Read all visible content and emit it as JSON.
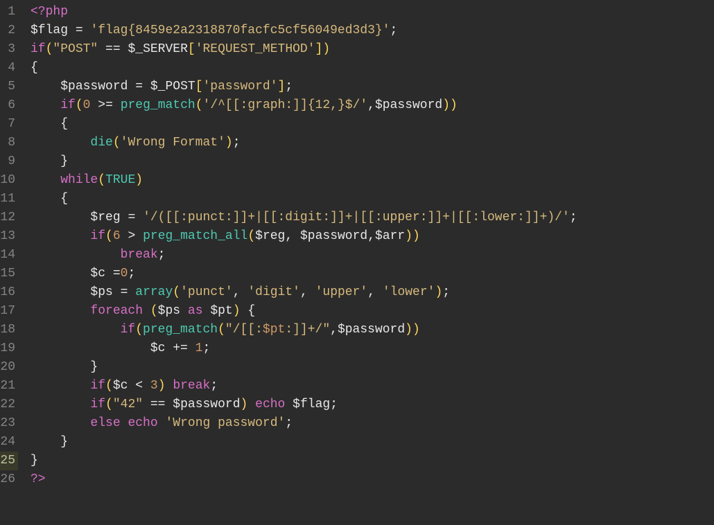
{
  "lineCount": 26,
  "currentLine": 25,
  "lines": [
    [
      {
        "t": "<?php",
        "c": "tk-tag"
      }
    ],
    [
      {
        "t": "$flag",
        "c": "tk-var"
      },
      {
        "t": " ",
        "c": "tk-default"
      },
      {
        "t": "=",
        "c": "tk-op"
      },
      {
        "t": " ",
        "c": "tk-default"
      },
      {
        "t": "'flag{8459e2a2318870facfc5cf56049ed3d3}'",
        "c": "tk-string"
      },
      {
        "t": ";",
        "c": "tk-punct"
      }
    ],
    [
      {
        "t": "if",
        "c": "tk-keyword"
      },
      {
        "t": "(",
        "c": "tk-paren"
      },
      {
        "t": "\"POST\"",
        "c": "tk-string"
      },
      {
        "t": " ",
        "c": "tk-default"
      },
      {
        "t": "==",
        "c": "tk-op"
      },
      {
        "t": " ",
        "c": "tk-default"
      },
      {
        "t": "$_SERVER",
        "c": "tk-var"
      },
      {
        "t": "[",
        "c": "tk-paren"
      },
      {
        "t": "'REQUEST_METHOD'",
        "c": "tk-string"
      },
      {
        "t": "]",
        "c": "tk-paren"
      },
      {
        "t": ")",
        "c": "tk-paren"
      }
    ],
    [
      {
        "t": "{",
        "c": "tk-punct"
      }
    ],
    [
      {
        "t": "    ",
        "c": "tk-default"
      },
      {
        "t": "$password",
        "c": "tk-var"
      },
      {
        "t": " ",
        "c": "tk-default"
      },
      {
        "t": "=",
        "c": "tk-op"
      },
      {
        "t": " ",
        "c": "tk-default"
      },
      {
        "t": "$_POST",
        "c": "tk-var"
      },
      {
        "t": "[",
        "c": "tk-paren"
      },
      {
        "t": "'password'",
        "c": "tk-string"
      },
      {
        "t": "]",
        "c": "tk-paren"
      },
      {
        "t": ";",
        "c": "tk-punct"
      }
    ],
    [
      {
        "t": "    ",
        "c": "tk-default"
      },
      {
        "t": "if",
        "c": "tk-keyword"
      },
      {
        "t": "(",
        "c": "tk-paren"
      },
      {
        "t": "0",
        "c": "tk-number"
      },
      {
        "t": " ",
        "c": "tk-default"
      },
      {
        "t": ">=",
        "c": "tk-op"
      },
      {
        "t": " ",
        "c": "tk-default"
      },
      {
        "t": "preg_match",
        "c": "tk-func"
      },
      {
        "t": "(",
        "c": "tk-paren"
      },
      {
        "t": "'/^[[:graph:]]{12,}$/'",
        "c": "tk-string"
      },
      {
        "t": ",",
        "c": "tk-punct"
      },
      {
        "t": "$password",
        "c": "tk-var"
      },
      {
        "t": ")",
        "c": "tk-paren"
      },
      {
        "t": ")",
        "c": "tk-paren"
      }
    ],
    [
      {
        "t": "    ",
        "c": "tk-default"
      },
      {
        "t": "{",
        "c": "tk-punct"
      }
    ],
    [
      {
        "t": "        ",
        "c": "tk-default"
      },
      {
        "t": "die",
        "c": "tk-func"
      },
      {
        "t": "(",
        "c": "tk-paren"
      },
      {
        "t": "'Wrong Format'",
        "c": "tk-string"
      },
      {
        "t": ")",
        "c": "tk-paren"
      },
      {
        "t": ";",
        "c": "tk-punct"
      }
    ],
    [
      {
        "t": "    ",
        "c": "tk-default"
      },
      {
        "t": "}",
        "c": "tk-punct"
      }
    ],
    [
      {
        "t": "    ",
        "c": "tk-default"
      },
      {
        "t": "while",
        "c": "tk-keyword"
      },
      {
        "t": "(",
        "c": "tk-paren"
      },
      {
        "t": "TRUE",
        "c": "tk-const"
      },
      {
        "t": ")",
        "c": "tk-paren"
      }
    ],
    [
      {
        "t": "    ",
        "c": "tk-default"
      },
      {
        "t": "{",
        "c": "tk-punct"
      }
    ],
    [
      {
        "t": "        ",
        "c": "tk-default"
      },
      {
        "t": "$reg",
        "c": "tk-var"
      },
      {
        "t": " ",
        "c": "tk-default"
      },
      {
        "t": "=",
        "c": "tk-op"
      },
      {
        "t": " ",
        "c": "tk-default"
      },
      {
        "t": "'/([[:punct:]]+|[[:digit:]]+|[[:upper:]]+|[[:lower:]]+)/'",
        "c": "tk-string"
      },
      {
        "t": ";",
        "c": "tk-punct"
      }
    ],
    [
      {
        "t": "        ",
        "c": "tk-default"
      },
      {
        "t": "if",
        "c": "tk-keyword"
      },
      {
        "t": "(",
        "c": "tk-paren"
      },
      {
        "t": "6",
        "c": "tk-number"
      },
      {
        "t": " ",
        "c": "tk-default"
      },
      {
        "t": ">",
        "c": "tk-op"
      },
      {
        "t": " ",
        "c": "tk-default"
      },
      {
        "t": "preg_match_all",
        "c": "tk-func"
      },
      {
        "t": "(",
        "c": "tk-paren"
      },
      {
        "t": "$reg",
        "c": "tk-var"
      },
      {
        "t": ",",
        "c": "tk-punct"
      },
      {
        "t": " ",
        "c": "tk-default"
      },
      {
        "t": "$password",
        "c": "tk-var"
      },
      {
        "t": ",",
        "c": "tk-punct"
      },
      {
        "t": "$arr",
        "c": "tk-var"
      },
      {
        "t": ")",
        "c": "tk-paren"
      },
      {
        "t": ")",
        "c": "tk-paren"
      }
    ],
    [
      {
        "t": "            ",
        "c": "tk-default"
      },
      {
        "t": "break",
        "c": "tk-keyword"
      },
      {
        "t": ";",
        "c": "tk-punct"
      }
    ],
    [
      {
        "t": "        ",
        "c": "tk-default"
      },
      {
        "t": "$c",
        "c": "tk-var"
      },
      {
        "t": " ",
        "c": "tk-default"
      },
      {
        "t": "=",
        "c": "tk-op"
      },
      {
        "t": "0",
        "c": "tk-number"
      },
      {
        "t": ";",
        "c": "tk-punct"
      }
    ],
    [
      {
        "t": "        ",
        "c": "tk-default"
      },
      {
        "t": "$ps",
        "c": "tk-var"
      },
      {
        "t": " ",
        "c": "tk-default"
      },
      {
        "t": "=",
        "c": "tk-op"
      },
      {
        "t": " ",
        "c": "tk-default"
      },
      {
        "t": "array",
        "c": "tk-func"
      },
      {
        "t": "(",
        "c": "tk-paren"
      },
      {
        "t": "'punct'",
        "c": "tk-string"
      },
      {
        "t": ",",
        "c": "tk-punct"
      },
      {
        "t": " ",
        "c": "tk-default"
      },
      {
        "t": "'digit'",
        "c": "tk-string"
      },
      {
        "t": ",",
        "c": "tk-punct"
      },
      {
        "t": " ",
        "c": "tk-default"
      },
      {
        "t": "'upper'",
        "c": "tk-string"
      },
      {
        "t": ",",
        "c": "tk-punct"
      },
      {
        "t": " ",
        "c": "tk-default"
      },
      {
        "t": "'lower'",
        "c": "tk-string"
      },
      {
        "t": ")",
        "c": "tk-paren"
      },
      {
        "t": ";",
        "c": "tk-punct"
      }
    ],
    [
      {
        "t": "        ",
        "c": "tk-default"
      },
      {
        "t": "foreach",
        "c": "tk-keyword"
      },
      {
        "t": " ",
        "c": "tk-default"
      },
      {
        "t": "(",
        "c": "tk-paren"
      },
      {
        "t": "$ps",
        "c": "tk-var"
      },
      {
        "t": " ",
        "c": "tk-default"
      },
      {
        "t": "as",
        "c": "tk-keyword"
      },
      {
        "t": " ",
        "c": "tk-default"
      },
      {
        "t": "$pt",
        "c": "tk-var"
      },
      {
        "t": ")",
        "c": "tk-paren"
      },
      {
        "t": " ",
        "c": "tk-default"
      },
      {
        "t": "{",
        "c": "tk-punct"
      }
    ],
    [
      {
        "t": "            ",
        "c": "tk-default"
      },
      {
        "t": "if",
        "c": "tk-keyword"
      },
      {
        "t": "(",
        "c": "tk-paren"
      },
      {
        "t": "preg_match",
        "c": "tk-func"
      },
      {
        "t": "(",
        "c": "tk-paren"
      },
      {
        "t": "\"/[[:",
        "c": "tk-string"
      },
      {
        "t": "$pt",
        "c": "tk-interp"
      },
      {
        "t": ":]]+/\"",
        "c": "tk-string"
      },
      {
        "t": ",",
        "c": "tk-punct"
      },
      {
        "t": "$password",
        "c": "tk-var"
      },
      {
        "t": ")",
        "c": "tk-paren"
      },
      {
        "t": ")",
        "c": "tk-paren"
      }
    ],
    [
      {
        "t": "                ",
        "c": "tk-default"
      },
      {
        "t": "$c",
        "c": "tk-var"
      },
      {
        "t": " ",
        "c": "tk-default"
      },
      {
        "t": "+=",
        "c": "tk-op"
      },
      {
        "t": " ",
        "c": "tk-default"
      },
      {
        "t": "1",
        "c": "tk-number"
      },
      {
        "t": ";",
        "c": "tk-punct"
      }
    ],
    [
      {
        "t": "        ",
        "c": "tk-default"
      },
      {
        "t": "}",
        "c": "tk-punct"
      }
    ],
    [
      {
        "t": "        ",
        "c": "tk-default"
      },
      {
        "t": "if",
        "c": "tk-keyword"
      },
      {
        "t": "(",
        "c": "tk-paren"
      },
      {
        "t": "$c",
        "c": "tk-var"
      },
      {
        "t": " ",
        "c": "tk-default"
      },
      {
        "t": "<",
        "c": "tk-op"
      },
      {
        "t": " ",
        "c": "tk-default"
      },
      {
        "t": "3",
        "c": "tk-number"
      },
      {
        "t": ")",
        "c": "tk-paren"
      },
      {
        "t": " ",
        "c": "tk-default"
      },
      {
        "t": "break",
        "c": "tk-keyword"
      },
      {
        "t": ";",
        "c": "tk-punct"
      }
    ],
    [
      {
        "t": "        ",
        "c": "tk-default"
      },
      {
        "t": "if",
        "c": "tk-keyword"
      },
      {
        "t": "(",
        "c": "tk-paren"
      },
      {
        "t": "\"42\"",
        "c": "tk-string"
      },
      {
        "t": " ",
        "c": "tk-default"
      },
      {
        "t": "==",
        "c": "tk-op"
      },
      {
        "t": " ",
        "c": "tk-default"
      },
      {
        "t": "$password",
        "c": "tk-var"
      },
      {
        "t": ")",
        "c": "tk-paren"
      },
      {
        "t": " ",
        "c": "tk-default"
      },
      {
        "t": "echo",
        "c": "tk-keyword"
      },
      {
        "t": " ",
        "c": "tk-default"
      },
      {
        "t": "$flag",
        "c": "tk-var"
      },
      {
        "t": ";",
        "c": "tk-punct"
      }
    ],
    [
      {
        "t": "        ",
        "c": "tk-default"
      },
      {
        "t": "else",
        "c": "tk-keyword"
      },
      {
        "t": " ",
        "c": "tk-default"
      },
      {
        "t": "echo",
        "c": "tk-keyword"
      },
      {
        "t": " ",
        "c": "tk-default"
      },
      {
        "t": "'Wrong password'",
        "c": "tk-string"
      },
      {
        "t": ";",
        "c": "tk-punct"
      }
    ],
    [
      {
        "t": "    ",
        "c": "tk-default"
      },
      {
        "t": "}",
        "c": "tk-punct"
      }
    ],
    [
      {
        "t": "}",
        "c": "tk-punct"
      }
    ],
    [
      {
        "t": "?>",
        "c": "tk-tag"
      }
    ]
  ]
}
